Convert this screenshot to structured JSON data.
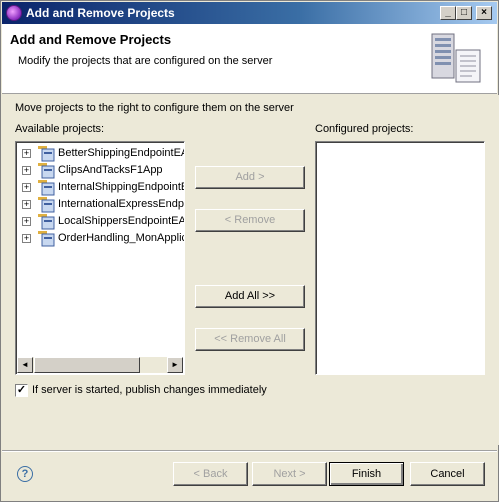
{
  "window": {
    "title": "Add and Remove Projects",
    "controls": {
      "minimize": "_",
      "maximize": "□",
      "close": "×"
    }
  },
  "header": {
    "title": "Add and Remove Projects",
    "description": "Modify the projects that are configured on the server"
  },
  "content": {
    "instruction": "Move projects to the right to configure them on the server",
    "available_label": "Available projects:",
    "configured_label": "Configured projects:",
    "available_projects": [
      {
        "label": "BetterShippingEndpointEAR",
        "expander": "+",
        "icon": "ear-project-icon"
      },
      {
        "label": "ClipsAndTacksF1App",
        "expander": "+",
        "icon": "ear-project-icon"
      },
      {
        "label": "InternalShippingEndpointEAR",
        "expander": "+",
        "icon": "ear-project-icon"
      },
      {
        "label": "InternationalExpressEndpointEAR",
        "expander": "+",
        "icon": "ear-project-icon"
      },
      {
        "label": "LocalShippersEndpointEAR",
        "expander": "+",
        "icon": "ear-project-icon"
      },
      {
        "label": "OrderHandling_MonApplication",
        "expander": "+",
        "icon": "ear-project-icon"
      }
    ],
    "configured_projects": [],
    "scroll_arrows": {
      "left": "◄",
      "right": "►"
    },
    "buttons": {
      "add": "Add >",
      "remove": "< Remove",
      "add_all": "Add All >>",
      "remove_all": "<< Remove All"
    },
    "publish_checkbox": {
      "label": "If server is started, publish changes immediately",
      "checked": true,
      "mark": "✓"
    }
  },
  "footer": {
    "help": "?",
    "back": "< Back",
    "next": "Next >",
    "finish": "Finish",
    "cancel": "Cancel"
  }
}
